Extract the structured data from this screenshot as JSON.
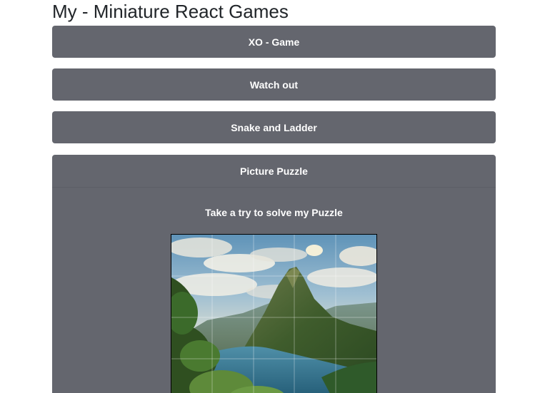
{
  "page": {
    "title": "My - Miniature React Games"
  },
  "games": [
    {
      "label": "XO - Game"
    },
    {
      "label": "Watch out"
    },
    {
      "label": "Snake and Ladder"
    },
    {
      "label": "Picture Puzzle"
    }
  ],
  "puzzle": {
    "subtitle": "Take a try to solve my Puzzle"
  },
  "colors": {
    "bar_bg": "#64666e",
    "bar_text": "#ffffff",
    "title_text": "#212529"
  }
}
